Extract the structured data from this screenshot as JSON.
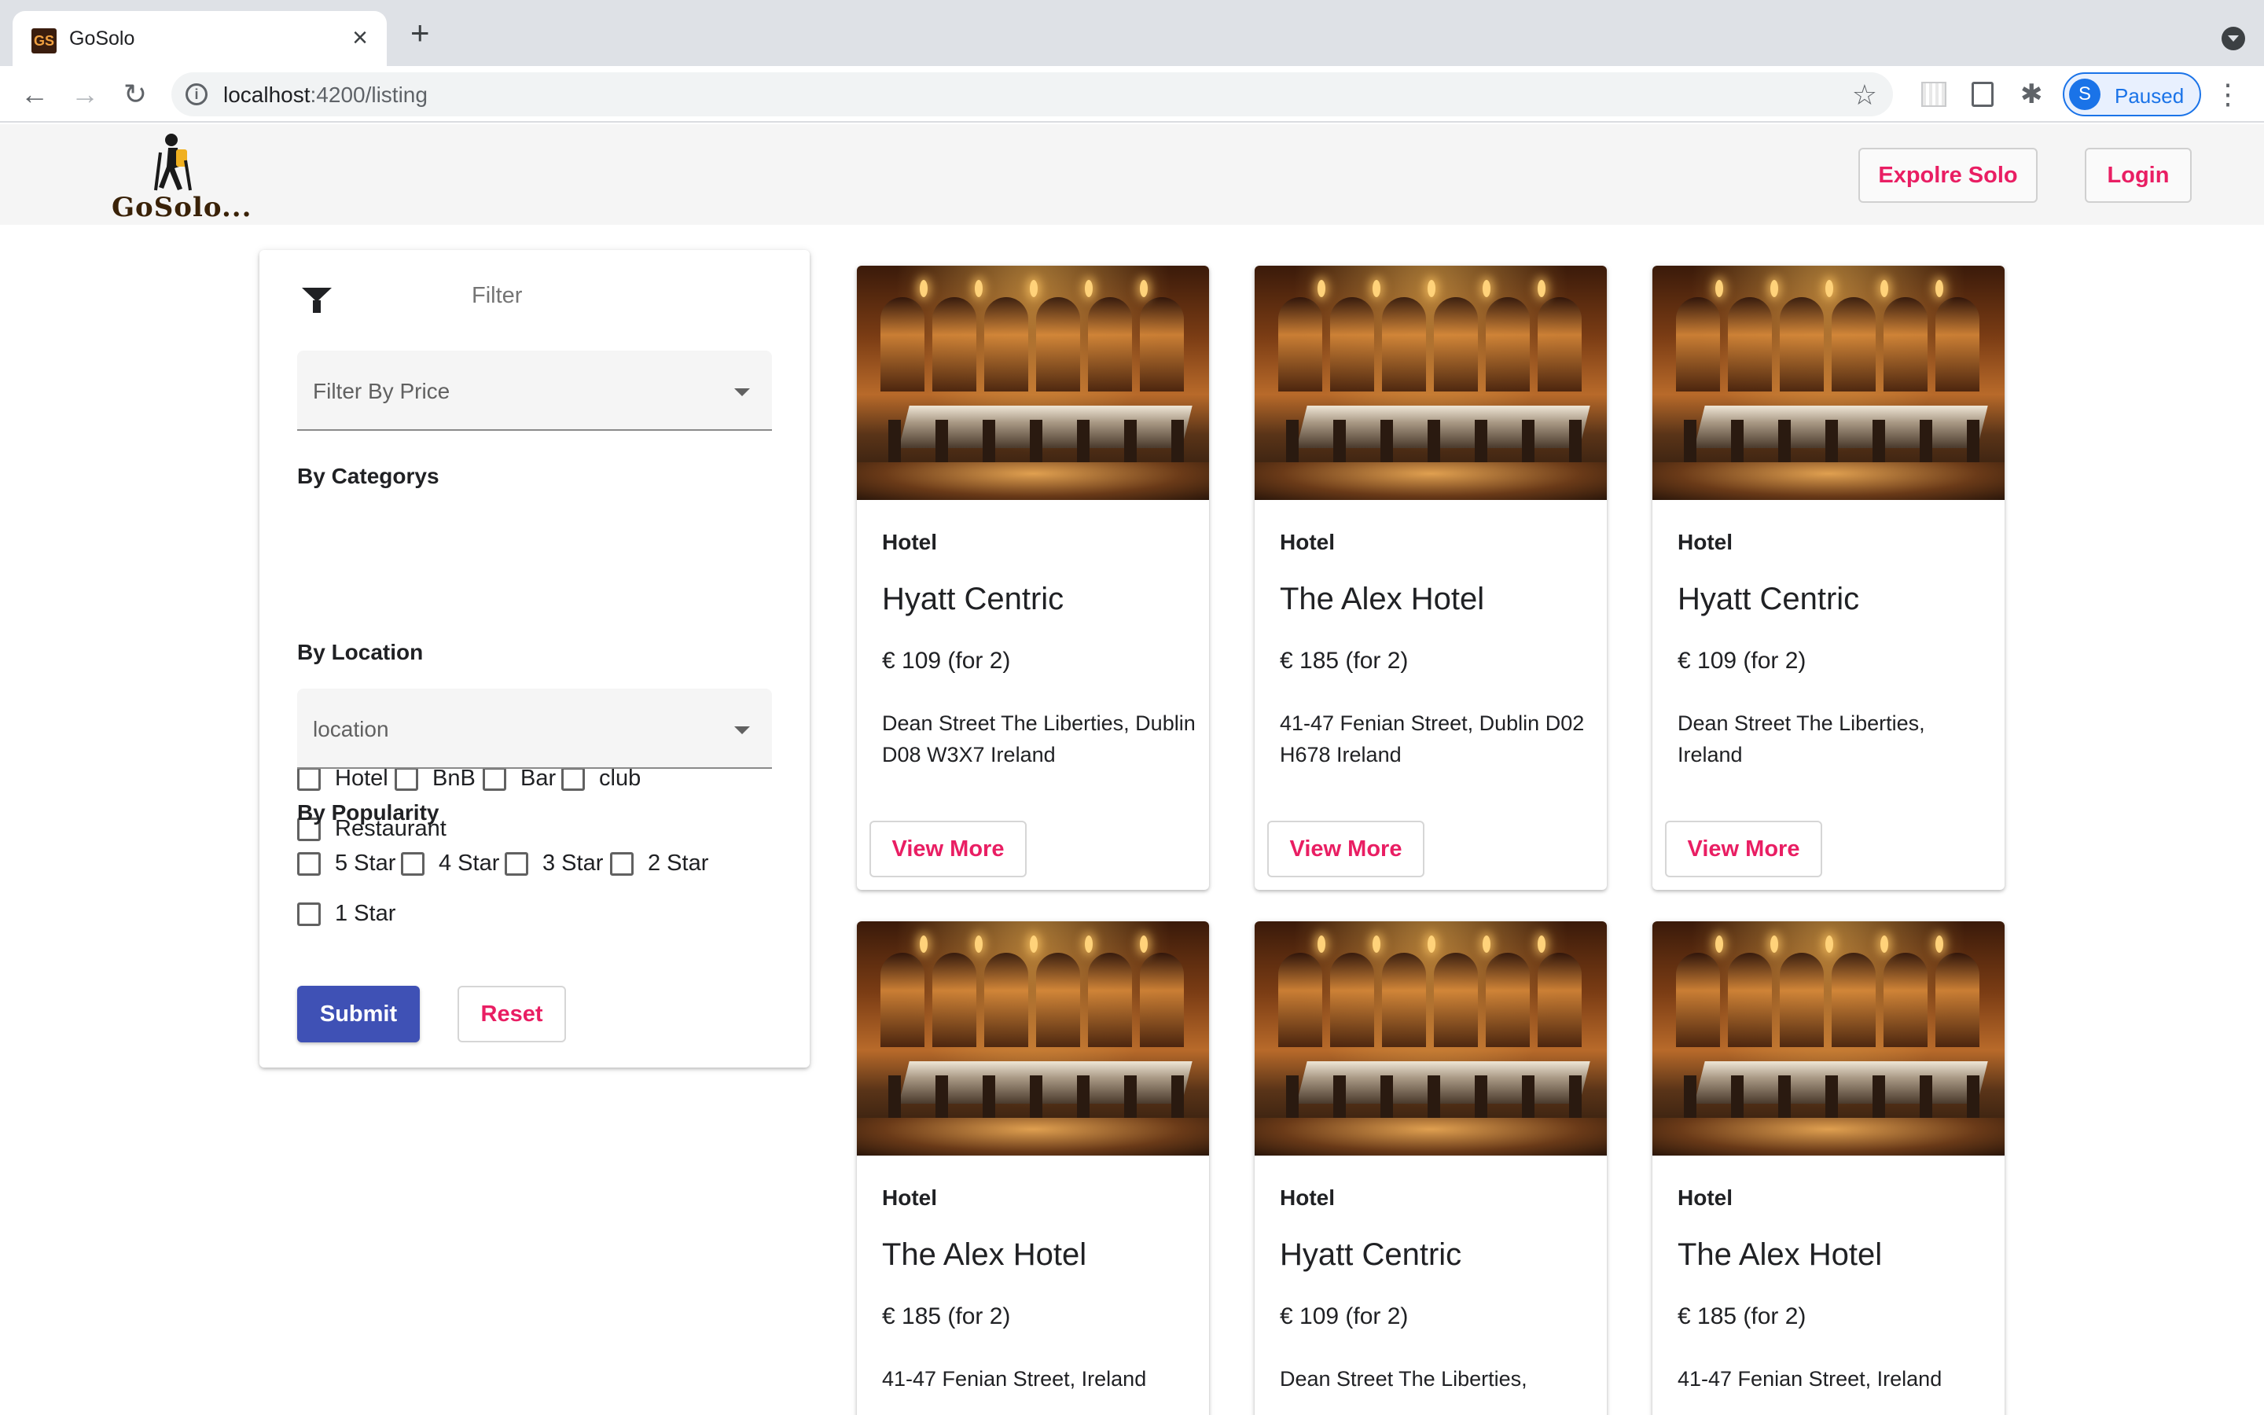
{
  "browser": {
    "tab_title": "GoSolo",
    "favicon_text": "GS",
    "url_host": "localhost",
    "url_rest": ":4200/listing",
    "profile_initial": "S",
    "profile_status": "Paused"
  },
  "header": {
    "logo_text": "GoSolo...",
    "explore_label": "Expolre Solo",
    "login_label": "Login",
    "accent_color": "#e91e63"
  },
  "filter": {
    "title": "Filter",
    "price_placeholder": "Filter By Price",
    "categories_title": "By Categorys",
    "categories": [
      {
        "label": "Hotel",
        "checked": false
      },
      {
        "label": "BnB",
        "checked": false
      },
      {
        "label": "Bar",
        "checked": false
      },
      {
        "label": "club",
        "checked": false
      },
      {
        "label": "Restaurant",
        "checked": false
      }
    ],
    "location_title": "By Location",
    "location_placeholder": "location",
    "popularity_title": "By Popularity",
    "popularity": [
      {
        "label": "5 Star",
        "checked": false
      },
      {
        "label": "4 Star",
        "checked": false
      },
      {
        "label": "3 Star",
        "checked": false
      },
      {
        "label": "2 Star",
        "checked": false
      },
      {
        "label": "1 Star",
        "checked": false
      }
    ],
    "submit_label": "Submit",
    "reset_label": "Reset",
    "submit_color": "#3f51b5"
  },
  "listings": [
    {
      "category": "Hotel",
      "name": "Hyatt Centric",
      "price": "€ 109 (for 2)",
      "address": "Dean Street The Liberties, Dublin D08 W3X7 Ireland",
      "button": "View More"
    },
    {
      "category": "Hotel",
      "name": "The Alex Hotel",
      "price": "€ 185 (for 2)",
      "address": "41-47 Fenian Street, Dublin D02 H678 Ireland",
      "button": "View More"
    },
    {
      "category": "Hotel",
      "name": "Hyatt Centric",
      "price": "€ 109 (for 2)",
      "address": "Dean Street The Liberties, Ireland",
      "button": "View More"
    },
    {
      "category": "Hotel",
      "name": "The Alex Hotel",
      "price": "€ 185 (for 2)",
      "address": "41-47 Fenian Street, Ireland",
      "button": ""
    },
    {
      "category": "Hotel",
      "name": "Hyatt Centric",
      "price": "€ 109 (for 2)",
      "address": "Dean Street The Liberties,",
      "button": ""
    },
    {
      "category": "Hotel",
      "name": "The Alex Hotel",
      "price": "€ 185 (for 2)",
      "address": "41-47 Fenian Street, Ireland",
      "button": ""
    }
  ]
}
